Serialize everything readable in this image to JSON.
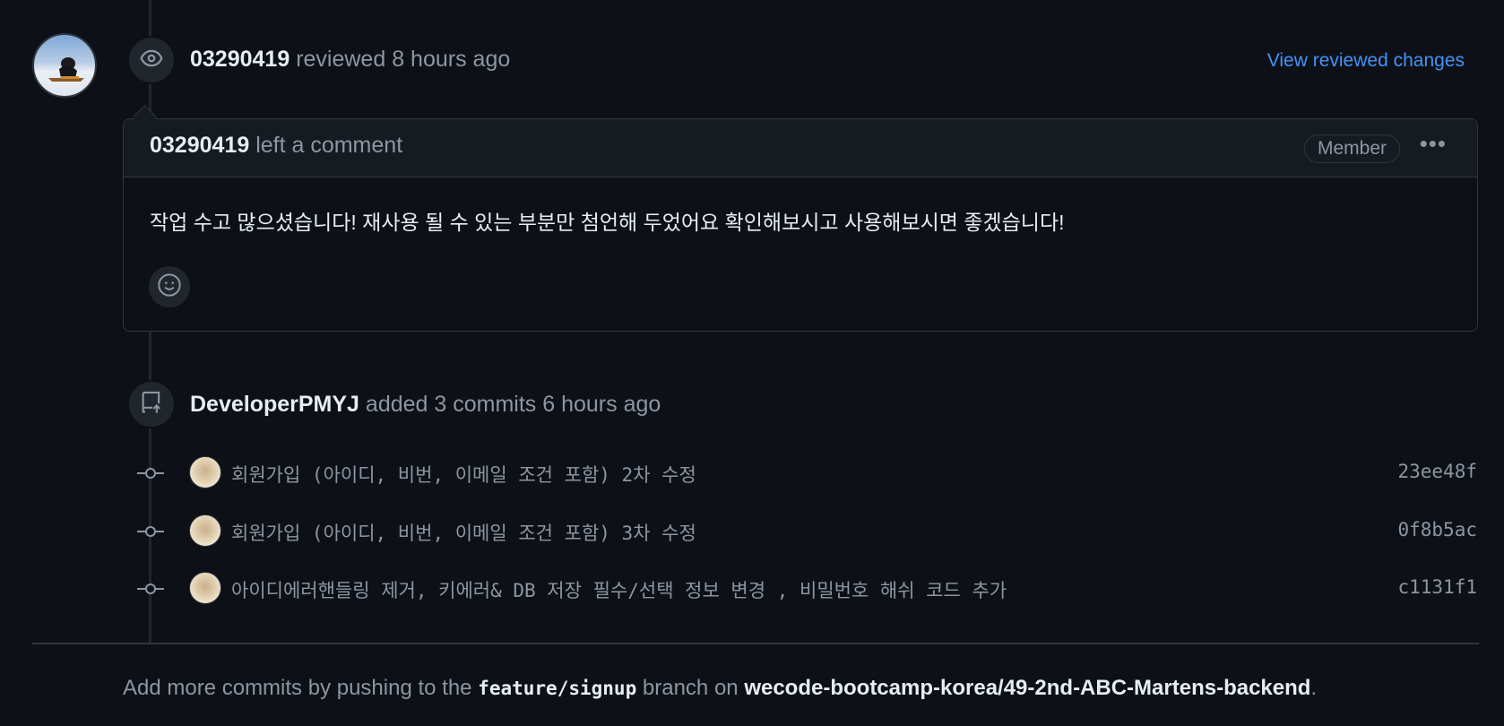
{
  "review": {
    "author": "03290419",
    "action": "reviewed",
    "time": "8 hours ago",
    "link_label": "View reviewed changes"
  },
  "comment": {
    "author": "03290419",
    "action": "left a comment",
    "badge": "Member",
    "menu_label": "•••",
    "body": "작업 수고 많으셨습니다! 재사용 될 수 있는 부분만 첨언해 두었어요 확인해보시고 사용해보시면 좋겠습니다!"
  },
  "commits_event": {
    "author": "DeveloperPMYJ",
    "action": "added 3 commits",
    "time": "6 hours ago"
  },
  "commits": [
    {
      "message": "회원가입 (아이디, 비번, 이메일 조건 포함) 2차 수정",
      "sha": "23ee48f"
    },
    {
      "message": "회원가입 (아이디, 비번, 이메일 조건 포함) 3차 수정",
      "sha": "0f8b5ac"
    },
    {
      "message": "아이디에러핸들링 제거, 키에러& DB 저장 필수/선택 정보 변경 , 비밀번호 해쉬 코드 추가",
      "sha": "c1131f1"
    }
  ],
  "footer": {
    "prefix": "Add more commits by pushing to the",
    "branch": "feature/signup",
    "middle": "branch on",
    "repo": "wecode-bootcamp-korea/49-2nd-ABC-Martens-backend",
    "suffix": "."
  },
  "icons": {
    "review": "eye-icon",
    "commits": "repo-push-icon",
    "reaction": "smiley-icon",
    "commit": "git-commit-icon"
  },
  "colors": {
    "background": "#0d1117",
    "link": "#4493f8",
    "muted": "#8d96a0",
    "border": "#30363d"
  }
}
